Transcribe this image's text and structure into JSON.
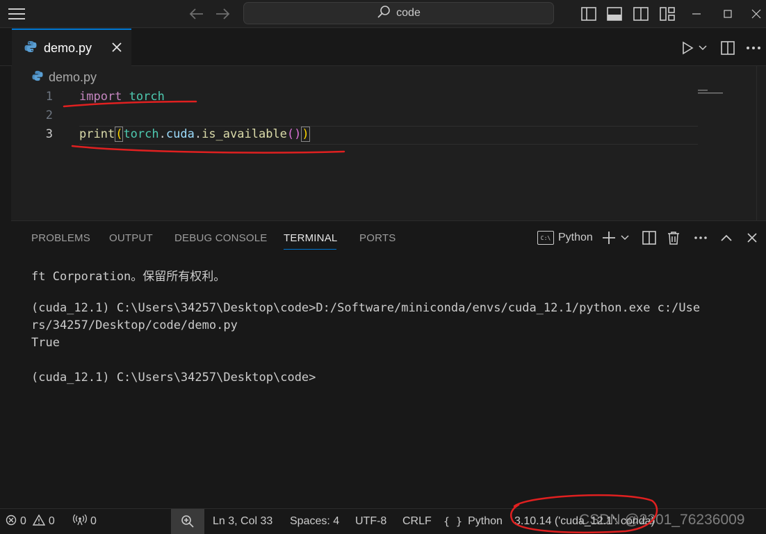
{
  "titlebar": {
    "search_text": "code"
  },
  "tab": {
    "label": "demo.py"
  },
  "breadcrumb": {
    "file": "demo.py"
  },
  "editor": {
    "lines": [
      {
        "number": "1",
        "tokens": [
          "import",
          "torch"
        ]
      },
      {
        "number": "2",
        "tokens": []
      },
      {
        "number": "3",
        "tokens": [
          "print",
          "(",
          "torch",
          ".",
          "cuda",
          ".",
          "is_available",
          "(",
          ")",
          ")"
        ]
      }
    ]
  },
  "panel": {
    "tabs": [
      "PROBLEMS",
      "OUTPUT",
      "DEBUG CONSOLE",
      "TERMINAL",
      "PORTS"
    ],
    "active_tab": "TERMINAL",
    "terminal_profile": "Python",
    "terminal_profile_icon": "C:\\",
    "terminal_lines": [
      "ft Corporation。保留所有权利。",
      "",
      "(cuda_12.1) C:\\Users\\34257\\Desktop\\code>D:/Software/miniconda/envs/cuda_12.1/python.exe c:/Use",
      "rs/34257/Desktop/code/demo.py",
      "True",
      "",
      "(cuda_12.1) C:\\Users\\34257\\Desktop\\code>"
    ]
  },
  "statusbar": {
    "errors": "0",
    "warnings": "0",
    "ports": "0",
    "position": "Ln 3, Col 33",
    "spaces": "Spaces: 4",
    "encoding": "UTF-8",
    "eol": "CRLF",
    "language": "Python",
    "interpreter": "3.10.14 ('cuda_12.1': conda)"
  },
  "watermark": "CSDN @2301_76236009",
  "colors": {
    "accent": "#0078d4",
    "keyword": "#c586c0",
    "module": "#4ec9b0",
    "function": "#dcdcaa",
    "annotation": "#e02020"
  }
}
